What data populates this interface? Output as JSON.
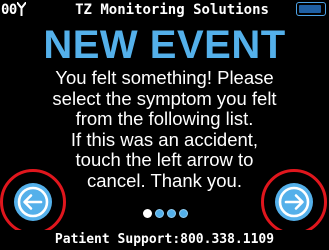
{
  "status_bar": {
    "signal_text": "00",
    "signal_icon": "antenna-icon",
    "title": "TZ Monitoring Solutions",
    "battery_icon": "battery-icon",
    "battery_level": 0.95,
    "battery_color": "#4da3e6"
  },
  "main": {
    "headline": "NEW EVENT",
    "message_lines": [
      "You felt something! Please",
      "select the symptom you felt",
      "from the following list.",
      "If this was an accident,",
      "touch the left arrow to",
      "cancel. Thank you."
    ]
  },
  "navigation": {
    "back_icon": "arrow-left-icon",
    "next_icon": "arrow-right-icon",
    "button_color": "#54b0ea",
    "highlight_color": "#e0161d"
  },
  "pager": {
    "total": 4,
    "current": 1,
    "active_color": "#ffffff",
    "inactive_color": "#54b0ea"
  },
  "footer": {
    "support_text": "Patient Support:800.338.1109"
  },
  "colors": {
    "background": "#000000",
    "accent": "#54b0ea",
    "text": "#ffffff"
  }
}
